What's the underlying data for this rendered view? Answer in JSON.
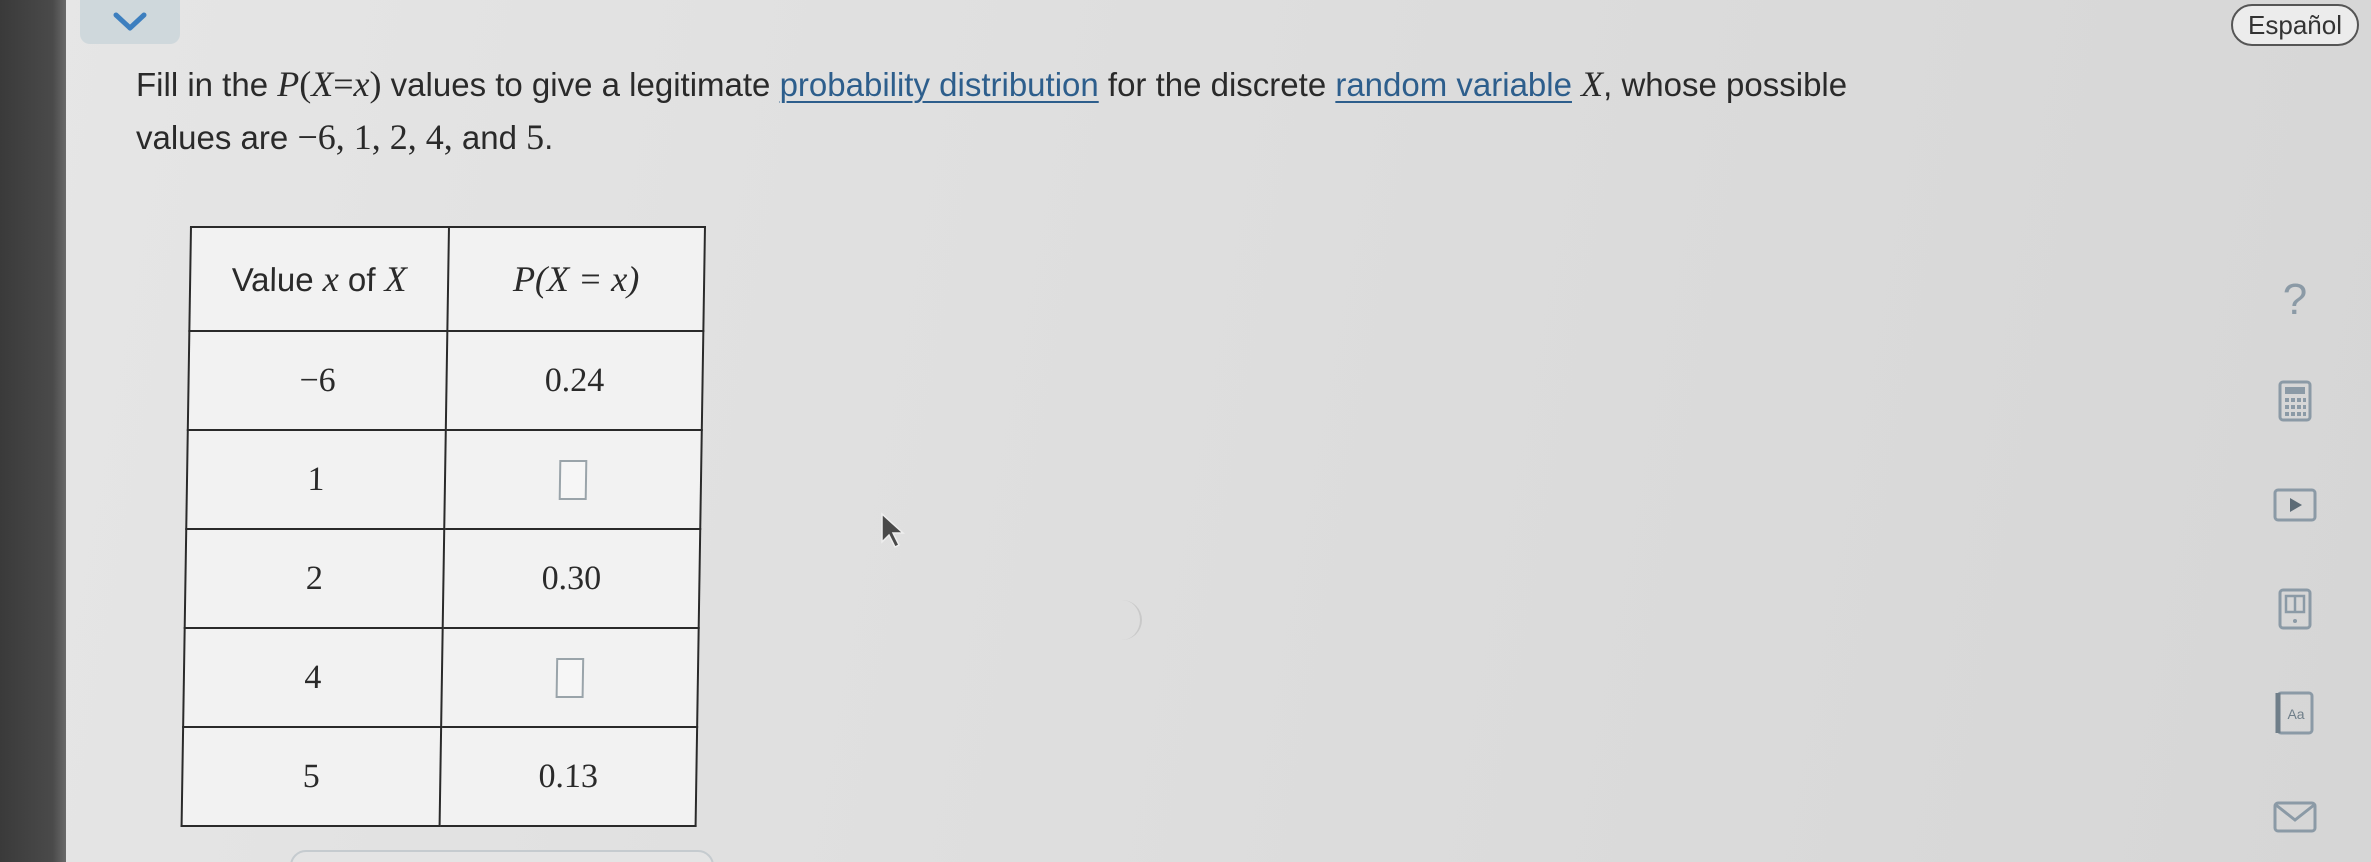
{
  "language_button": "Español",
  "question": {
    "part1": "Fill in the ",
    "p": "P",
    "paren_open": "(",
    "big_x": "X",
    "equals": "=",
    "small_x": "x",
    "paren_close": ")",
    "part2": " values to give a legitimate ",
    "link1": "probability distribution",
    "part3": " for the discrete ",
    "link2": "random variable",
    "part4": " ",
    "var": "X",
    "part5": ", whose possible",
    "line2_start": "values are ",
    "values": "−6, 1, 2, 4,",
    "and": " and ",
    "last_value": "5",
    "period": "."
  },
  "table": {
    "header_value_prefix": "Value ",
    "header_value_x": "x",
    "header_value_of": " of ",
    "header_value_X": "X",
    "header_prob_P": "P",
    "header_prob_expr": "(X = x)",
    "rows": [
      {
        "x": "−6",
        "p": "0.24",
        "editable": false
      },
      {
        "x": "1",
        "p": "",
        "editable": true
      },
      {
        "x": "2",
        "p": "0.30",
        "editable": false
      },
      {
        "x": "4",
        "p": "",
        "editable": true
      },
      {
        "x": "5",
        "p": "0.13",
        "editable": false
      }
    ]
  },
  "tools": {
    "help": "?",
    "calculator": "calculator-icon",
    "video": "play-icon",
    "textbook": "book-icon",
    "glossary": "Aa",
    "message": "mail-icon"
  },
  "colors": {
    "link": "#2d5e8c",
    "icon": "#8b9aa6",
    "tab": "#cfd8dc"
  }
}
